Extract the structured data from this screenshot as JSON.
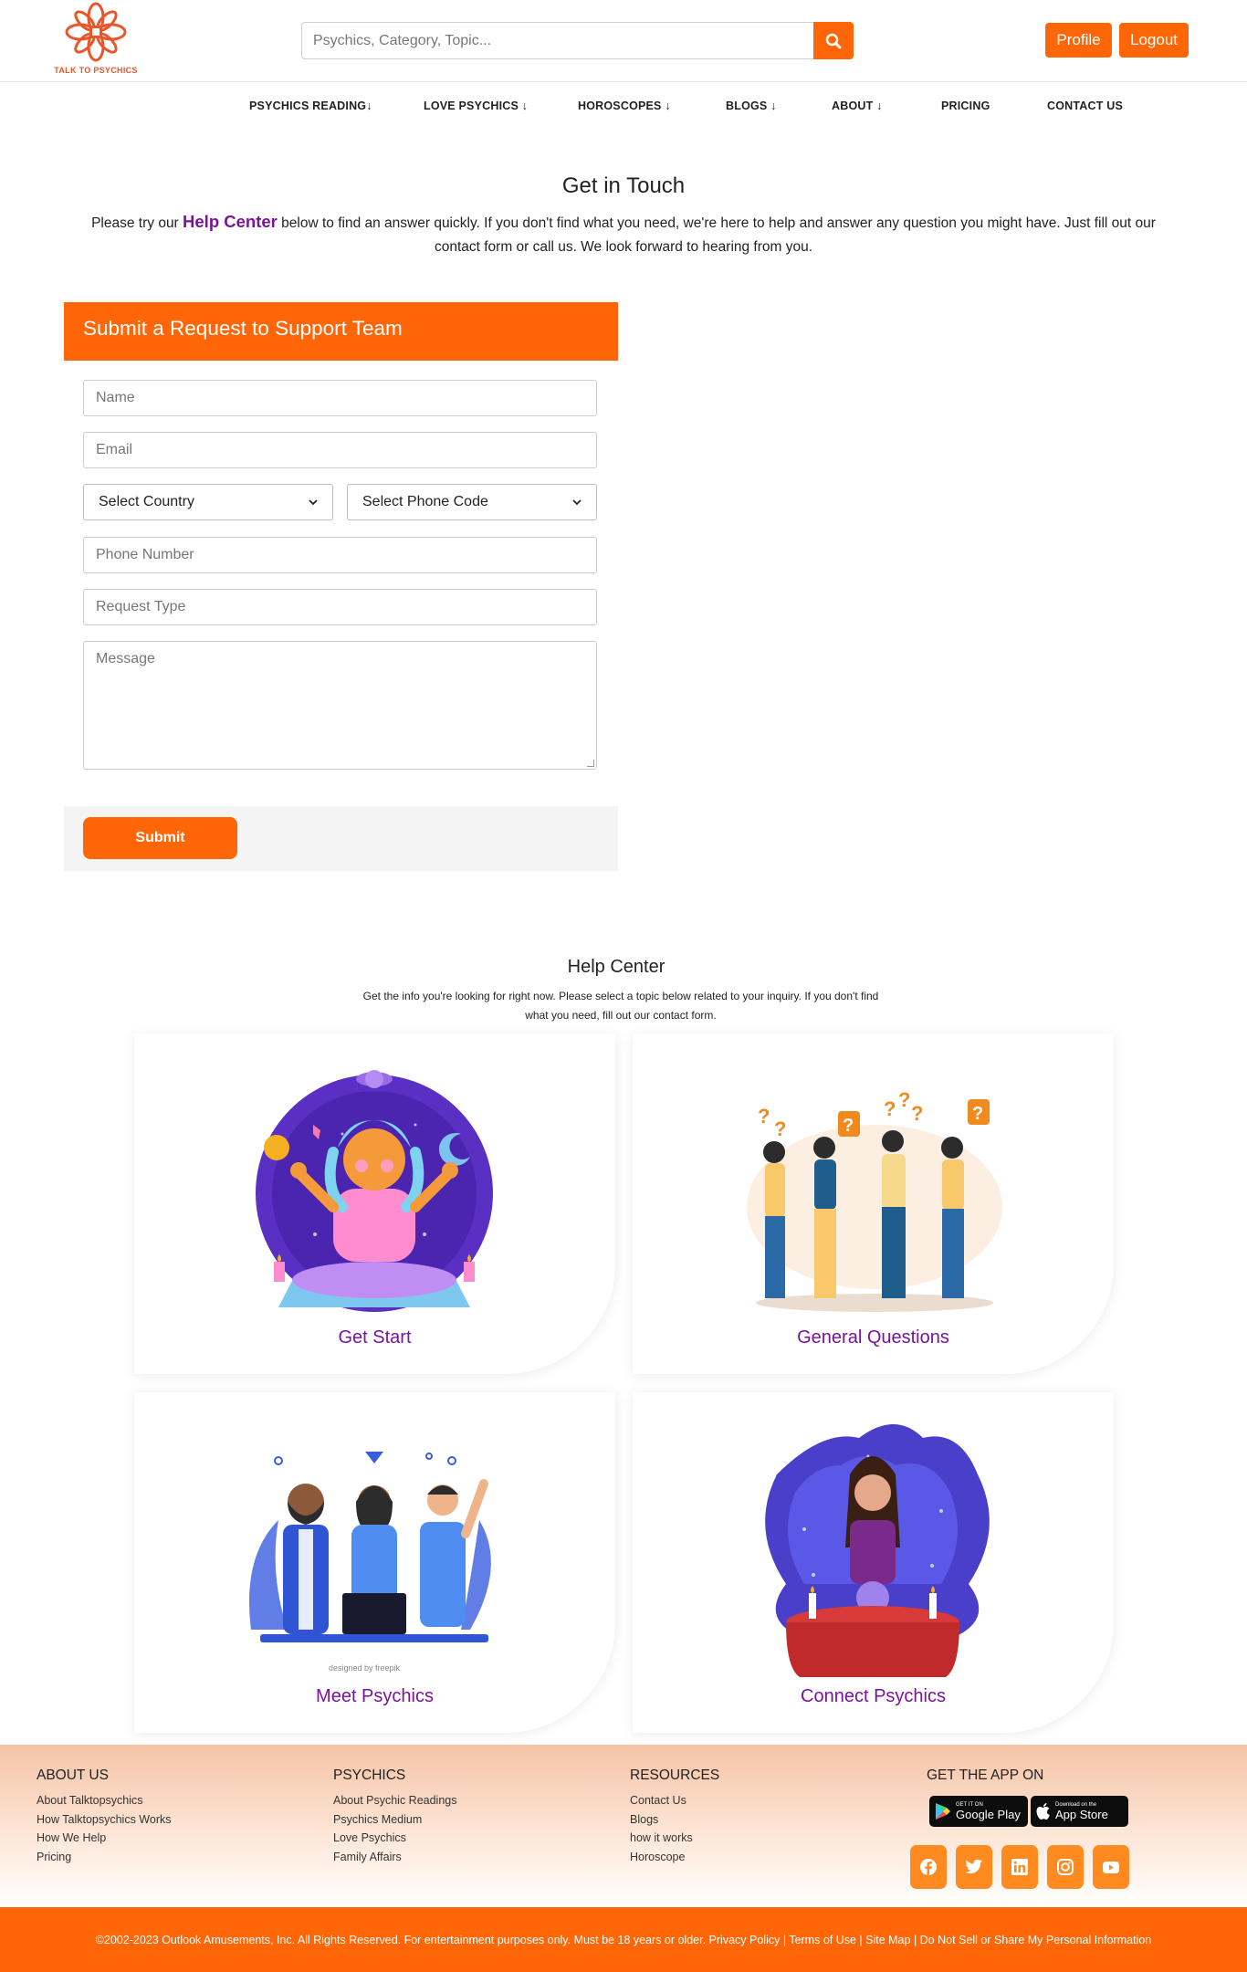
{
  "brand": {
    "logo_text": "TALK TO PSYCHICS",
    "accent": "#ff6608",
    "link_color": "#7a139a"
  },
  "search": {
    "placeholder": "Psychics, Category, Topic..."
  },
  "header": {
    "profile_label": "Profile",
    "logout_label": "Logout"
  },
  "nav": {
    "items": [
      {
        "label": "PSYCHICS READING↓"
      },
      {
        "label": "LOVE PSYCHICS ↓"
      },
      {
        "label": "HOROSCOPES ↓"
      },
      {
        "label": "BLOGS ↓"
      },
      {
        "label": "ABOUT ↓"
      },
      {
        "label": "PRICING"
      },
      {
        "label": "CONTACT US"
      }
    ]
  },
  "get_in_touch": {
    "title": "Get in Touch",
    "text_before": "Please try our ",
    "help_link": "Help Center",
    "text_after": " below to find an answer quickly. If you don't find what you need, we're here to help and answer any question you might have. Just fill out our contact form or call us. We look forward to hearing from you."
  },
  "form": {
    "heading": "Submit a Request to Support Team",
    "name_placeholder": "Name",
    "email_placeholder": "Email",
    "country_select": "Select Country",
    "phone_code_select": "Select Phone Code",
    "phone_placeholder": "Phone Number",
    "request_type_placeholder": "Request Type",
    "message_placeholder": "Message",
    "submit_label": "Submit"
  },
  "help_center": {
    "title": "Help Center",
    "subtitle": "Get the info you're looking for right now. Please select a topic below related to your inquiry. If you don't find what you need, fill out our contact form.",
    "cards": [
      {
        "label": "Get Start"
      },
      {
        "label": "General Questions"
      },
      {
        "label": "Meet Psychics"
      },
      {
        "label": "Connect Psychics"
      }
    ],
    "freepik_credit": "designed by  freepik"
  },
  "footer": {
    "about": {
      "title": "ABOUT US",
      "links": [
        "About Talktopsychics",
        "How Talktopsychics Works",
        "How We Help",
        "Pricing"
      ]
    },
    "psychics": {
      "title": "PSYCHICS",
      "links": [
        "About Psychic Readings",
        "Psychics Medium",
        "Love Psychics",
        "Family Affairs"
      ]
    },
    "resources": {
      "title": "RESOURCES",
      "links": [
        "Contact Us",
        "Blogs",
        "how it works",
        "Horoscope"
      ]
    },
    "app": {
      "title": "GET THE APP ON",
      "google_small": "GET IT ON",
      "google_big": "Google Play",
      "apple_small": "Download on the",
      "apple_big": "App Store"
    },
    "social_icons": [
      "facebook-icon",
      "twitter-icon",
      "linkedin-icon",
      "instagram-icon",
      "youtube-icon"
    ],
    "copyright": "©2002-2023 Outlook Amusements, Inc. All Rights Reserved. For entertainment purposes only. Must be 18 years or older. Privacy Policy | Terms of Use | Site Map | Do Not Sell or Share My Personal Information"
  }
}
